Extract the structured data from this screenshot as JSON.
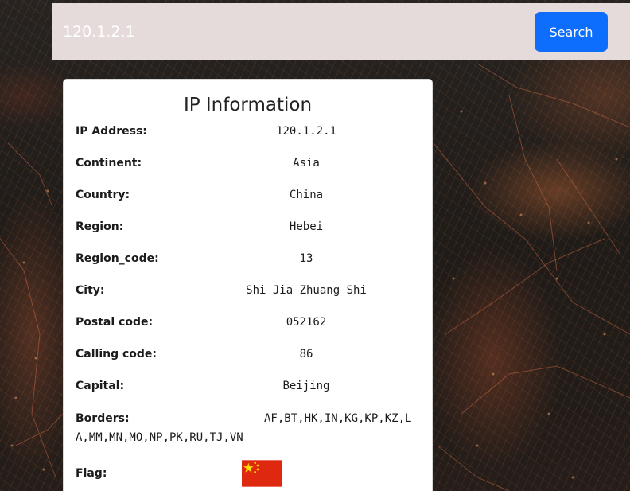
{
  "search": {
    "value": "120.1.2.1",
    "button_label": "Search"
  },
  "card": {
    "title": "IP Information",
    "rows": [
      {
        "label": "IP Address:",
        "value": "120.1.2.1"
      },
      {
        "label": "Continent:",
        "value": "Asia"
      },
      {
        "label": "Country:",
        "value": "China"
      },
      {
        "label": "Region:",
        "value": "Hebei"
      },
      {
        "label": "Region_code:",
        "value": "13"
      },
      {
        "label": "City:",
        "value": "Shi Jia Zhuang Shi"
      },
      {
        "label": "Postal code:",
        "value": "052162"
      },
      {
        "label": "Calling code:",
        "value": "86"
      },
      {
        "label": "Capital:",
        "value": "Beijing"
      }
    ],
    "borders": {
      "label": "Borders:",
      "value": "AF,BT,HK,IN,KG,KP,KZ,LA,MM,MN,MO,NP,PK,RU,TJ,VN"
    },
    "flag": {
      "label": "Flag:",
      "icon": "china-flag-icon",
      "colors": {
        "field": "#de2910",
        "stars": "#ffde00"
      }
    }
  }
}
